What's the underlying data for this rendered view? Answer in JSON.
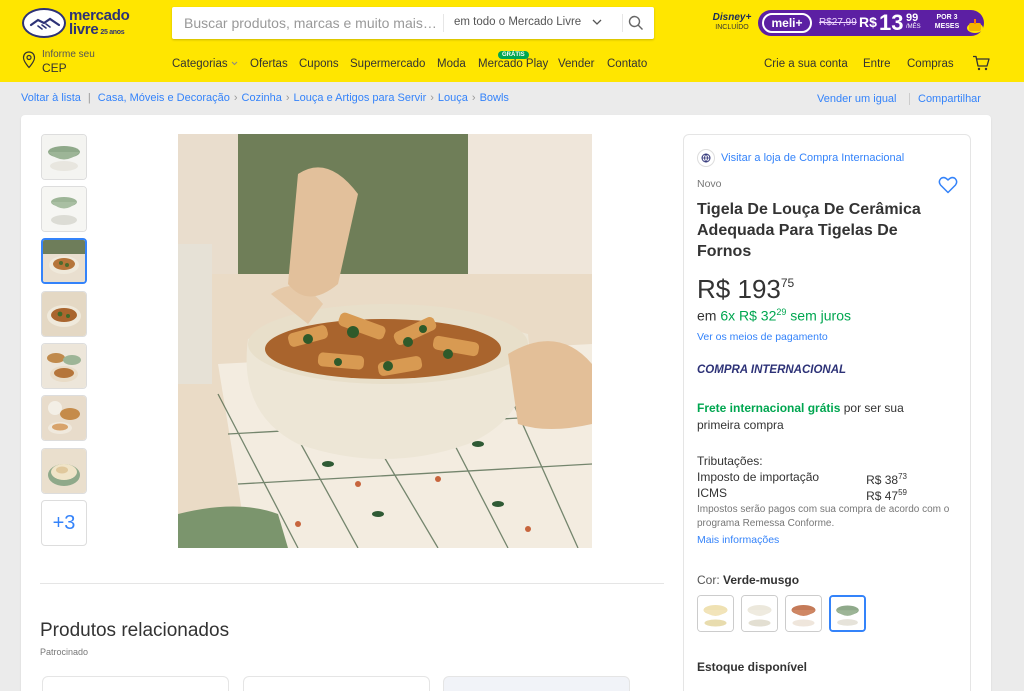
{
  "header": {
    "logo": {
      "brand_top": "mercado",
      "brand_bottom": "livre",
      "badge": "25 anos"
    },
    "cep": {
      "line1": "Informe seu",
      "line2": "CEP"
    },
    "search": {
      "placeholder": "Buscar produtos, marcas e muito mais…",
      "scope": "em todo o Mercado Livre"
    },
    "disney": {
      "brand": "Disney+",
      "label": "INCLUÍDO"
    },
    "meli": {
      "badge": "meli+",
      "old_price": "R$27,99",
      "currency": "R$",
      "price_int": "13",
      "price_cents": "99",
      "per": "/MÊS",
      "tag": "POR 3 MESES"
    },
    "nav": [
      {
        "label": "Categorias",
        "caret": true
      },
      {
        "label": "Ofertas"
      },
      {
        "label": "Cupons"
      },
      {
        "label": "Supermercado"
      },
      {
        "label": "Moda"
      },
      {
        "label": "Mercado Play",
        "badge": "GRÁTIS"
      },
      {
        "label": "Vender"
      },
      {
        "label": "Contato"
      }
    ],
    "account": {
      "create": "Crie a sua conta",
      "login": "Entre",
      "purchases": "Compras"
    }
  },
  "breadcrumb": {
    "back": "Voltar à lista",
    "items": [
      "Casa, Móveis e Decoração",
      "Cozinha",
      "Louça e Artigos para Servir",
      "Louça",
      "Bowls"
    ],
    "sell_similar": "Vender um igual",
    "share": "Compartilhar"
  },
  "gallery": {
    "more_count": "+3",
    "total_visible_thumbs": 7,
    "active_index": 2
  },
  "product": {
    "store_link": "Visitar a loja de Compra Internacional",
    "condition": "Novo",
    "title": "Tigela De Louça De Cerâmica Adequada Para Tigelas De Fornos",
    "price": {
      "currency": "R$",
      "int": "193",
      "cents": "75"
    },
    "installments": {
      "prefix": "em",
      "text": "6x R$ 32",
      "cents": "29",
      "suffix": "sem juros"
    },
    "payment_link": "Ver os meios de pagamento",
    "international": "COMPRA INTERNACIONAL",
    "shipping": {
      "highlight": "Frete internacional grátis",
      "rest": "por ser sua primeira compra"
    },
    "taxes": {
      "label": "Tributações:",
      "items": [
        {
          "name": "Imposto de importação",
          "value": "R$ 38",
          "cents": "73"
        },
        {
          "name": "ICMS",
          "value": "R$ 47",
          "cents": "59"
        }
      ],
      "note": "Impostos serão pagos com sua compra de acordo com o programa Remessa Conforme.",
      "more": "Mais informações"
    },
    "color": {
      "label": "Cor:",
      "value": "Verde-musgo",
      "options": [
        "yellow",
        "cream",
        "terracotta",
        "green"
      ],
      "selected_index": 3
    },
    "stock": "Estoque disponível"
  },
  "related": {
    "title": "Produtos relacionados",
    "sub": "Patrocinado"
  },
  "colors": {
    "header_bg": "#ffe600",
    "link": "#3483fa",
    "green": "#00a650",
    "meli_purple": "#5c1fa3",
    "brand_navy": "#2d3277"
  }
}
